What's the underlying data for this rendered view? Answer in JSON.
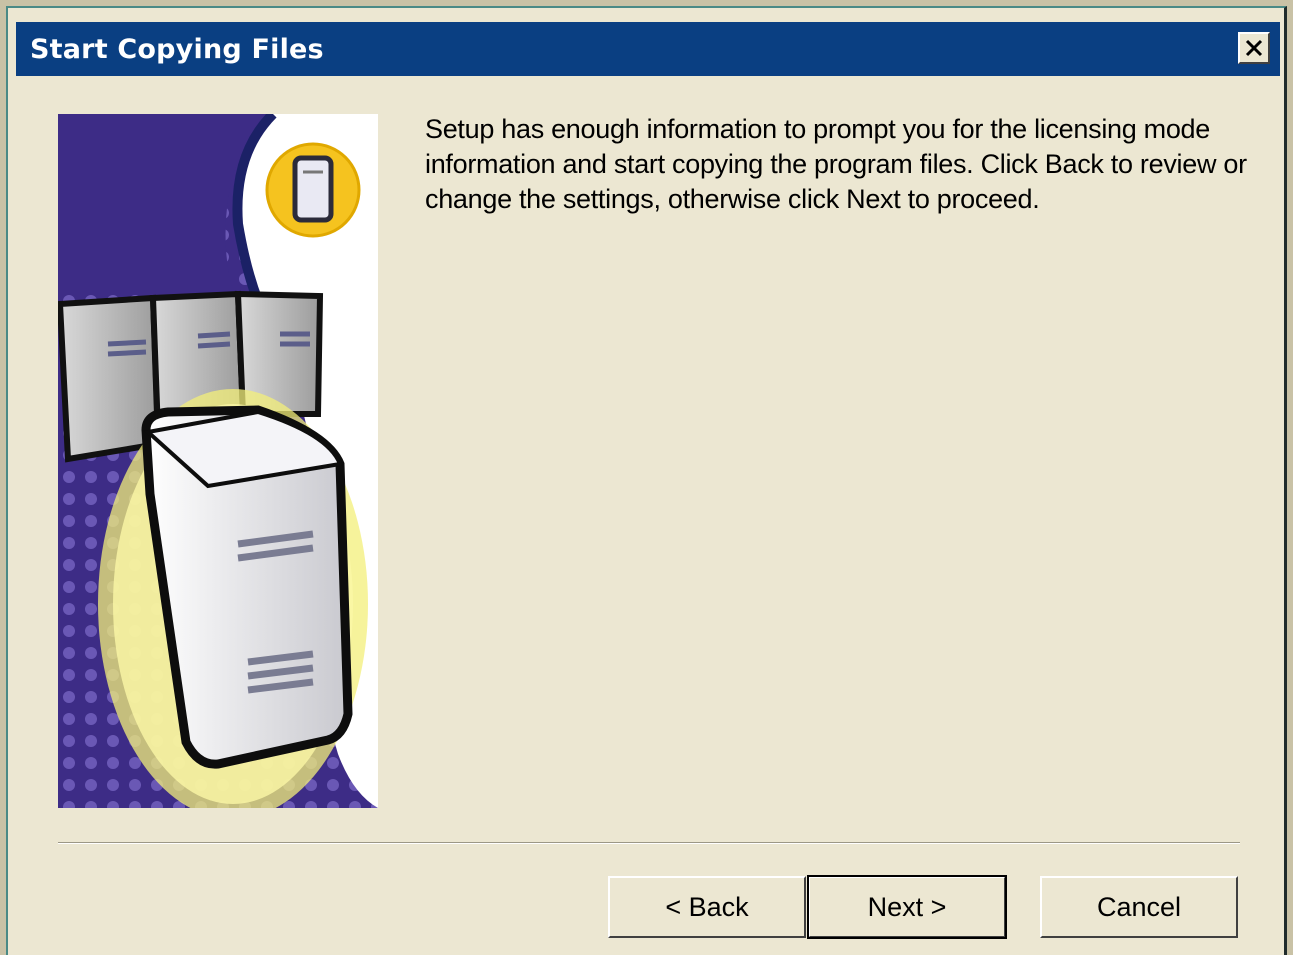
{
  "window": {
    "title": "Start Copying Files",
    "close_label": "×"
  },
  "content": {
    "message": "Setup has enough information to prompt you for the licensing mode information and start copying the program files.  Click Back to review or change the settings, otherwise click Next to proceed."
  },
  "buttons": {
    "back": "< Back",
    "next": "Next >",
    "cancel": "Cancel"
  },
  "colors": {
    "titlebar": "#0a3f82",
    "dialog_bg": "#ece7d2",
    "art_purple": "#3d2c86",
    "art_yellow": "#f5c31f"
  },
  "icons": {
    "close": "close-icon",
    "side": "server-illustration"
  }
}
